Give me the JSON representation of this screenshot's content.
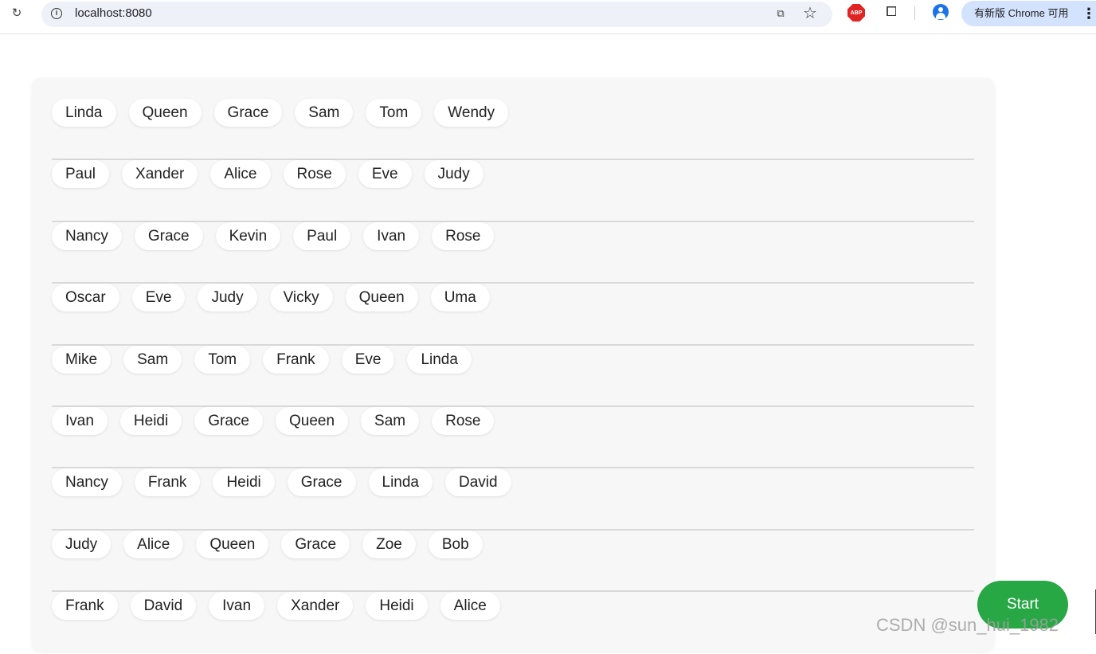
{
  "browser": {
    "url": "localhost:8080",
    "update_label": "有新版 Chrome 可用",
    "abp_label": "ABP"
  },
  "rows": [
    [
      "Linda",
      "Queen",
      "Grace",
      "Sam",
      "Tom",
      "Wendy"
    ],
    [
      "Paul",
      "Xander",
      "Alice",
      "Rose",
      "Eve",
      "Judy"
    ],
    [
      "Nancy",
      "Grace",
      "Kevin",
      "Paul",
      "Ivan",
      "Rose"
    ],
    [
      "Oscar",
      "Eve",
      "Judy",
      "Vicky",
      "Queen",
      "Uma"
    ],
    [
      "Mike",
      "Sam",
      "Tom",
      "Frank",
      "Eve",
      "Linda"
    ],
    [
      "Ivan",
      "Heidi",
      "Grace",
      "Queen",
      "Sam",
      "Rose"
    ],
    [
      "Nancy",
      "Frank",
      "Heidi",
      "Grace",
      "Linda",
      "David"
    ],
    [
      "Judy",
      "Alice",
      "Queen",
      "Grace",
      "Zoe",
      "Bob"
    ],
    [
      "Frank",
      "David",
      "Ivan",
      "Xander",
      "Heidi",
      "Alice"
    ]
  ],
  "start_label": "Start",
  "watermark": "CSDN @sun_hui_1982",
  "colors": {
    "start_button": "#28a745",
    "panel_bg": "#f7f7f7",
    "chip_bg": "#ffffff"
  }
}
